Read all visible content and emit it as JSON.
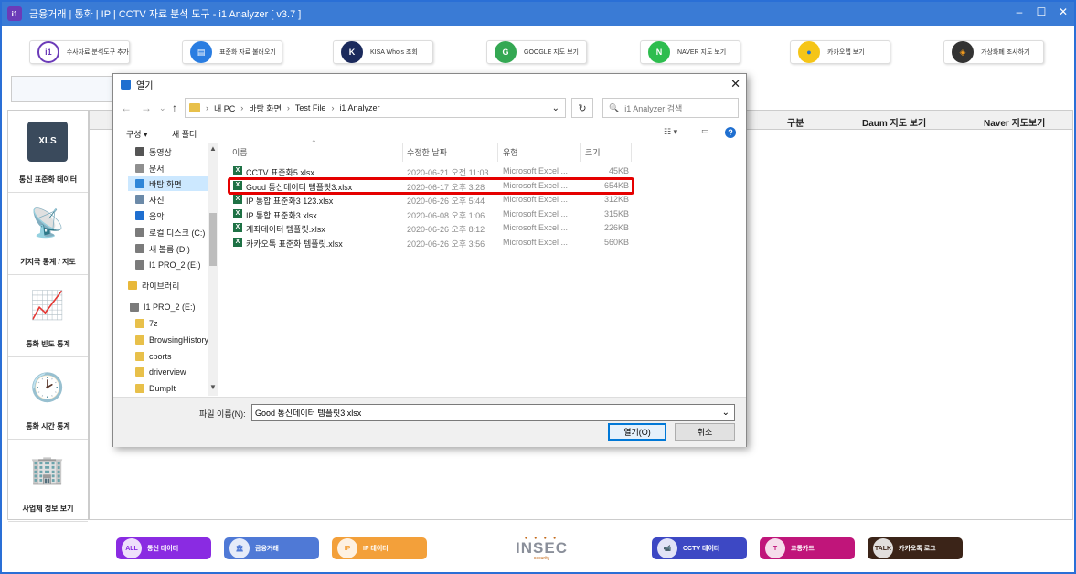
{
  "window": {
    "app_icon": "i1",
    "title": "금융거래 | 통화 | IP | CCTV 자료 분석 도구 - i1 Analyzer  [ v3.7 ]",
    "controls": {
      "minimize": "–",
      "maximize": "☐",
      "close": "✕"
    }
  },
  "toolbar": {
    "buttons": [
      {
        "label": "수사자료 분석도구 추가",
        "icon": "i1-logo-icon",
        "glyph": "i1"
      },
      {
        "label": "표준화 자료 불러오기",
        "icon": "document-icon",
        "glyph": "▤"
      },
      {
        "label": "KISA Whois 조회",
        "icon": "kisa-icon",
        "glyph": "K"
      },
      {
        "label": "GOOGLE 지도 보기",
        "icon": "google-maps-icon",
        "glyph": "G"
      },
      {
        "label": "NAVER 지도 보기",
        "icon": "naver-map-icon",
        "glyph": "N"
      },
      {
        "label": "카카오맵 보기",
        "icon": "kakao-map-icon",
        "glyph": "●"
      },
      {
        "label": "가상화폐 조사하기",
        "icon": "crypto-icon",
        "glyph": "◈"
      }
    ]
  },
  "sidebar": {
    "items": [
      {
        "label": "통신 표준화 데이터",
        "icon": "xls-file-icon",
        "glyph": "XLS"
      },
      {
        "label": "기지국 통계 / 지도",
        "icon": "cell-tower-icon",
        "glyph": "📡"
      },
      {
        "label": "통화 빈도 통계",
        "icon": "frequency-chart-icon",
        "glyph": "📈"
      },
      {
        "label": "통화 시간 통계",
        "icon": "clock-icon",
        "glyph": "🕑"
      },
      {
        "label": "사업체 정보 보기",
        "icon": "building-icon",
        "glyph": "🏢"
      }
    ]
  },
  "grid": {
    "columns": [
      "구분",
      "Daum 지도 보기",
      "Naver 지도보기"
    ]
  },
  "bottom_bar": {
    "buttons": [
      {
        "label": "통신 데이터",
        "icon": "telecom-icon",
        "glyph": "ALL",
        "color": "#8a2be2"
      },
      {
        "label": "금융거래",
        "icon": "bank-icon",
        "glyph": "🏛",
        "color": "#4f79d6"
      },
      {
        "label": "IP 데이터",
        "icon": "ip-map-icon",
        "glyph": "IP",
        "color": "#f3a03a"
      },
      {
        "label": "CCTV 데이터",
        "icon": "cctv-icon",
        "glyph": "📹",
        "color": "#3d48c4"
      },
      {
        "label": "교통카드",
        "icon": "transit-card-icon",
        "glyph": "T",
        "color": "#c0157a"
      },
      {
        "label": "카카오톡 로그",
        "icon": "kakaotalk-icon",
        "glyph": "TALK",
        "color": "#3b2418"
      }
    ],
    "brand": {
      "name": "INSEC",
      "tagline": "security"
    }
  },
  "dialog": {
    "title": "열기",
    "close": "✕",
    "nav": {
      "back": "←",
      "forward": "→",
      "dropdown": "⌄",
      "up": "↑"
    },
    "breadcrumb": [
      "내 PC",
      "바탕 화면",
      "Test File",
      "i1 Analyzer"
    ],
    "breadcrumb_sep": "›",
    "address_dropdown": "⌄",
    "refresh": "↻",
    "search_placeholder": "i1 Analyzer 검색",
    "search_icon": "🔍",
    "organize_label": "구성 ▾",
    "new_folder_label": "새 폴더",
    "view_icon": "☷ ▾",
    "pane_icon": "▭",
    "help_icon": "?",
    "nav_pane": [
      {
        "label": "동영상",
        "icon": "video-folder-icon",
        "color": "#555555"
      },
      {
        "label": "문서",
        "icon": "documents-folder-icon",
        "color": "#8f8f8f"
      },
      {
        "label": "바탕 화면",
        "icon": "desktop-folder-icon",
        "color": "#2f86d8",
        "selected": true
      },
      {
        "label": "사진",
        "icon": "pictures-folder-icon",
        "color": "#6c8aa8"
      },
      {
        "label": "음악",
        "icon": "music-folder-icon",
        "color": "#1f6fd0"
      },
      {
        "label": "로컬 디스크 (C:)",
        "icon": "drive-icon",
        "color": "#7b7b7b"
      },
      {
        "label": "새 볼륨 (D:)",
        "icon": "drive-icon",
        "color": "#7b7b7b"
      },
      {
        "label": "I1 PRO_2 (E:)",
        "icon": "drive-icon",
        "color": "#7b7b7b"
      },
      {
        "label": "라이브러리",
        "icon": "library-icon",
        "color": "#e8b83a"
      },
      {
        "label": "I1 PRO_2 (E:)",
        "icon": "drive-icon",
        "color": "#7b7b7b"
      },
      {
        "label": "7z",
        "icon": "folder-icon",
        "color": "#e8c04a"
      },
      {
        "label": "BrowsingHistory",
        "icon": "folder-icon",
        "color": "#e8c04a"
      },
      {
        "label": "cports",
        "icon": "folder-icon",
        "color": "#e8c04a"
      },
      {
        "label": "driverview",
        "icon": "folder-icon",
        "color": "#e8c04a"
      },
      {
        "label": "DumpIt",
        "icon": "folder-icon",
        "color": "#e8c04a"
      }
    ],
    "columns": {
      "name": "이름",
      "date": "수정한 날짜",
      "type": "유형",
      "size": "크기"
    },
    "files": [
      {
        "name": "CCTV 표준화5.xlsx",
        "date": "2020-06-21 오전 11:03",
        "type": "Microsoft Excel ...",
        "size": "45KB"
      },
      {
        "name": "Good 통신데이터 템플릿3.xlsx",
        "date": "2020-06-17 오후 3:28",
        "type": "Microsoft Excel ...",
        "size": "654KB",
        "highlighted": true
      },
      {
        "name": "IP 통합 표준화3 123.xlsx",
        "date": "2020-06-26 오후 5:44",
        "type": "Microsoft Excel ...",
        "size": "312KB"
      },
      {
        "name": "IP 통합 표준화3.xlsx",
        "date": "2020-06-08 오후 1:06",
        "type": "Microsoft Excel ...",
        "size": "315KB"
      },
      {
        "name": "계좌데이터 템플릿.xlsx",
        "date": "2020-06-26 오후 8:12",
        "type": "Microsoft Excel ...",
        "size": "226KB"
      },
      {
        "name": "카카오톡 표준화 템플릿.xlsx",
        "date": "2020-06-26 오후 3:56",
        "type": "Microsoft Excel ...",
        "size": "560KB"
      }
    ],
    "filename_label": "파일 이름(N):",
    "filename_value": "Good 통신데이터 템플릿3.xlsx",
    "open_label": "열기(O)",
    "cancel_label": "취소",
    "highlight_color": "#e50000"
  }
}
